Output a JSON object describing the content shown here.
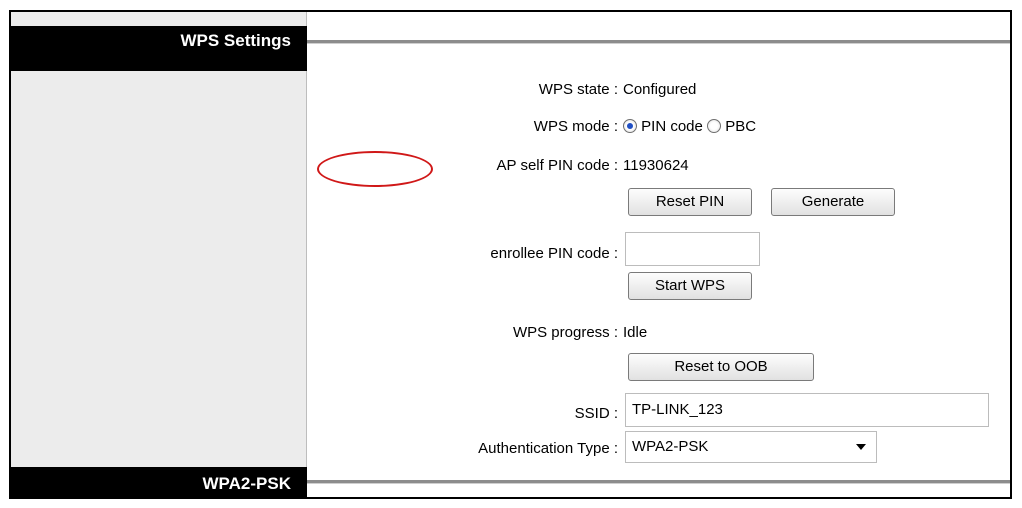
{
  "sections": {
    "wps_settings": "WPS Settings",
    "wpa2_psk": "WPA2-PSK"
  },
  "wps_state": {
    "label": "WPS state :",
    "value": "Configured"
  },
  "wps_mode": {
    "label": "WPS mode :",
    "options": [
      "PIN code",
      "PBC"
    ],
    "selected": "PIN code"
  },
  "ap_pin": {
    "label": "AP self PIN code :",
    "value": "11930624"
  },
  "buttons": {
    "reset_pin": "Reset PIN",
    "generate": "Generate",
    "start_wps": "Start WPS",
    "reset_oob": "Reset to OOB"
  },
  "enrollee_pin": {
    "label": "enrollee PIN code :",
    "value": ""
  },
  "wps_progress": {
    "label": "WPS progress :",
    "value": "Idle"
  },
  "ssid": {
    "label": "SSID :",
    "value": "TP-LINK_123"
  },
  "auth_type": {
    "label": "Authentication Type :",
    "value": "WPA2-PSK"
  },
  "colors": {
    "header_bg": "#000000",
    "sidebar_bg": "#ececec",
    "annotation": "#d01818"
  }
}
